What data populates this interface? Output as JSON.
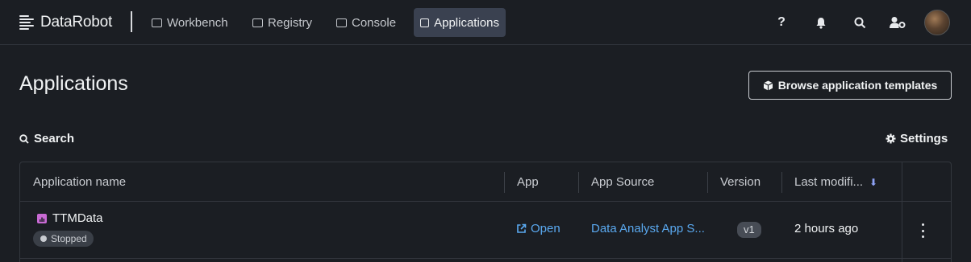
{
  "brand": {
    "name": "DataRobot"
  },
  "nav": [
    {
      "label": "Workbench",
      "icon": "workbench-icon",
      "active": false
    },
    {
      "label": "Registry",
      "icon": "registry-icon",
      "active": false
    },
    {
      "label": "Console",
      "icon": "console-icon",
      "active": false
    },
    {
      "label": "Applications",
      "icon": "applications-icon",
      "active": true
    }
  ],
  "topbar_icons": {
    "help": "?",
    "notifications": "🔔",
    "search": "⌕",
    "user_settings": "user-settings-icon"
  },
  "page": {
    "title": "Applications",
    "browse_button": "Browse application templates",
    "search_label": "Search",
    "settings_label": "Settings"
  },
  "table": {
    "columns": [
      "Application name",
      "App",
      "App Source",
      "Version",
      "Last modifi..."
    ],
    "sort_indicator": "⬇",
    "rows": [
      {
        "name": "TTMData",
        "status": "Stopped",
        "app_link": "Open",
        "source": "Data Analyst App S...",
        "version": "v1",
        "modified": "2 hours ago"
      }
    ]
  },
  "colors": {
    "background": "#1b1e23",
    "link": "#5aa9f0",
    "active_nav": "#3a4150",
    "app_icon": "#c86ad3"
  }
}
